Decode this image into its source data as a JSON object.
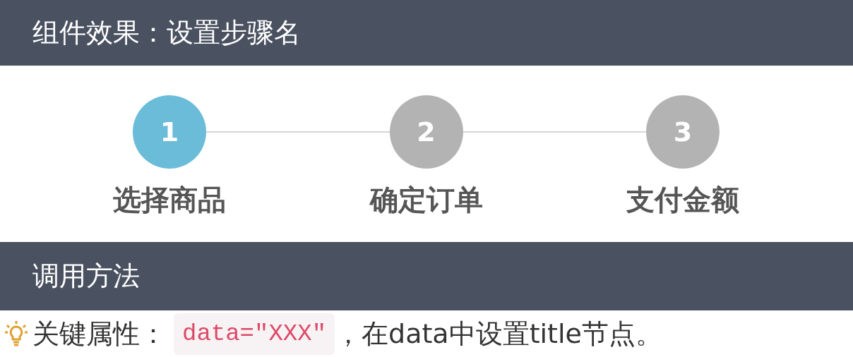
{
  "demo_header": {
    "title": "组件效果：设置步骤名"
  },
  "steps": [
    {
      "number": "1",
      "label": "选择商品",
      "selected": true
    },
    {
      "number": "2",
      "label": "确定订单",
      "selected": false
    },
    {
      "number": "3",
      "label": "支付金额",
      "selected": false
    }
  ],
  "usage_header": {
    "title": "调用方法"
  },
  "tip": {
    "label": "关键属性：",
    "code": "data=\"XXX\"",
    "text": "，在data中设置title节点。"
  }
}
